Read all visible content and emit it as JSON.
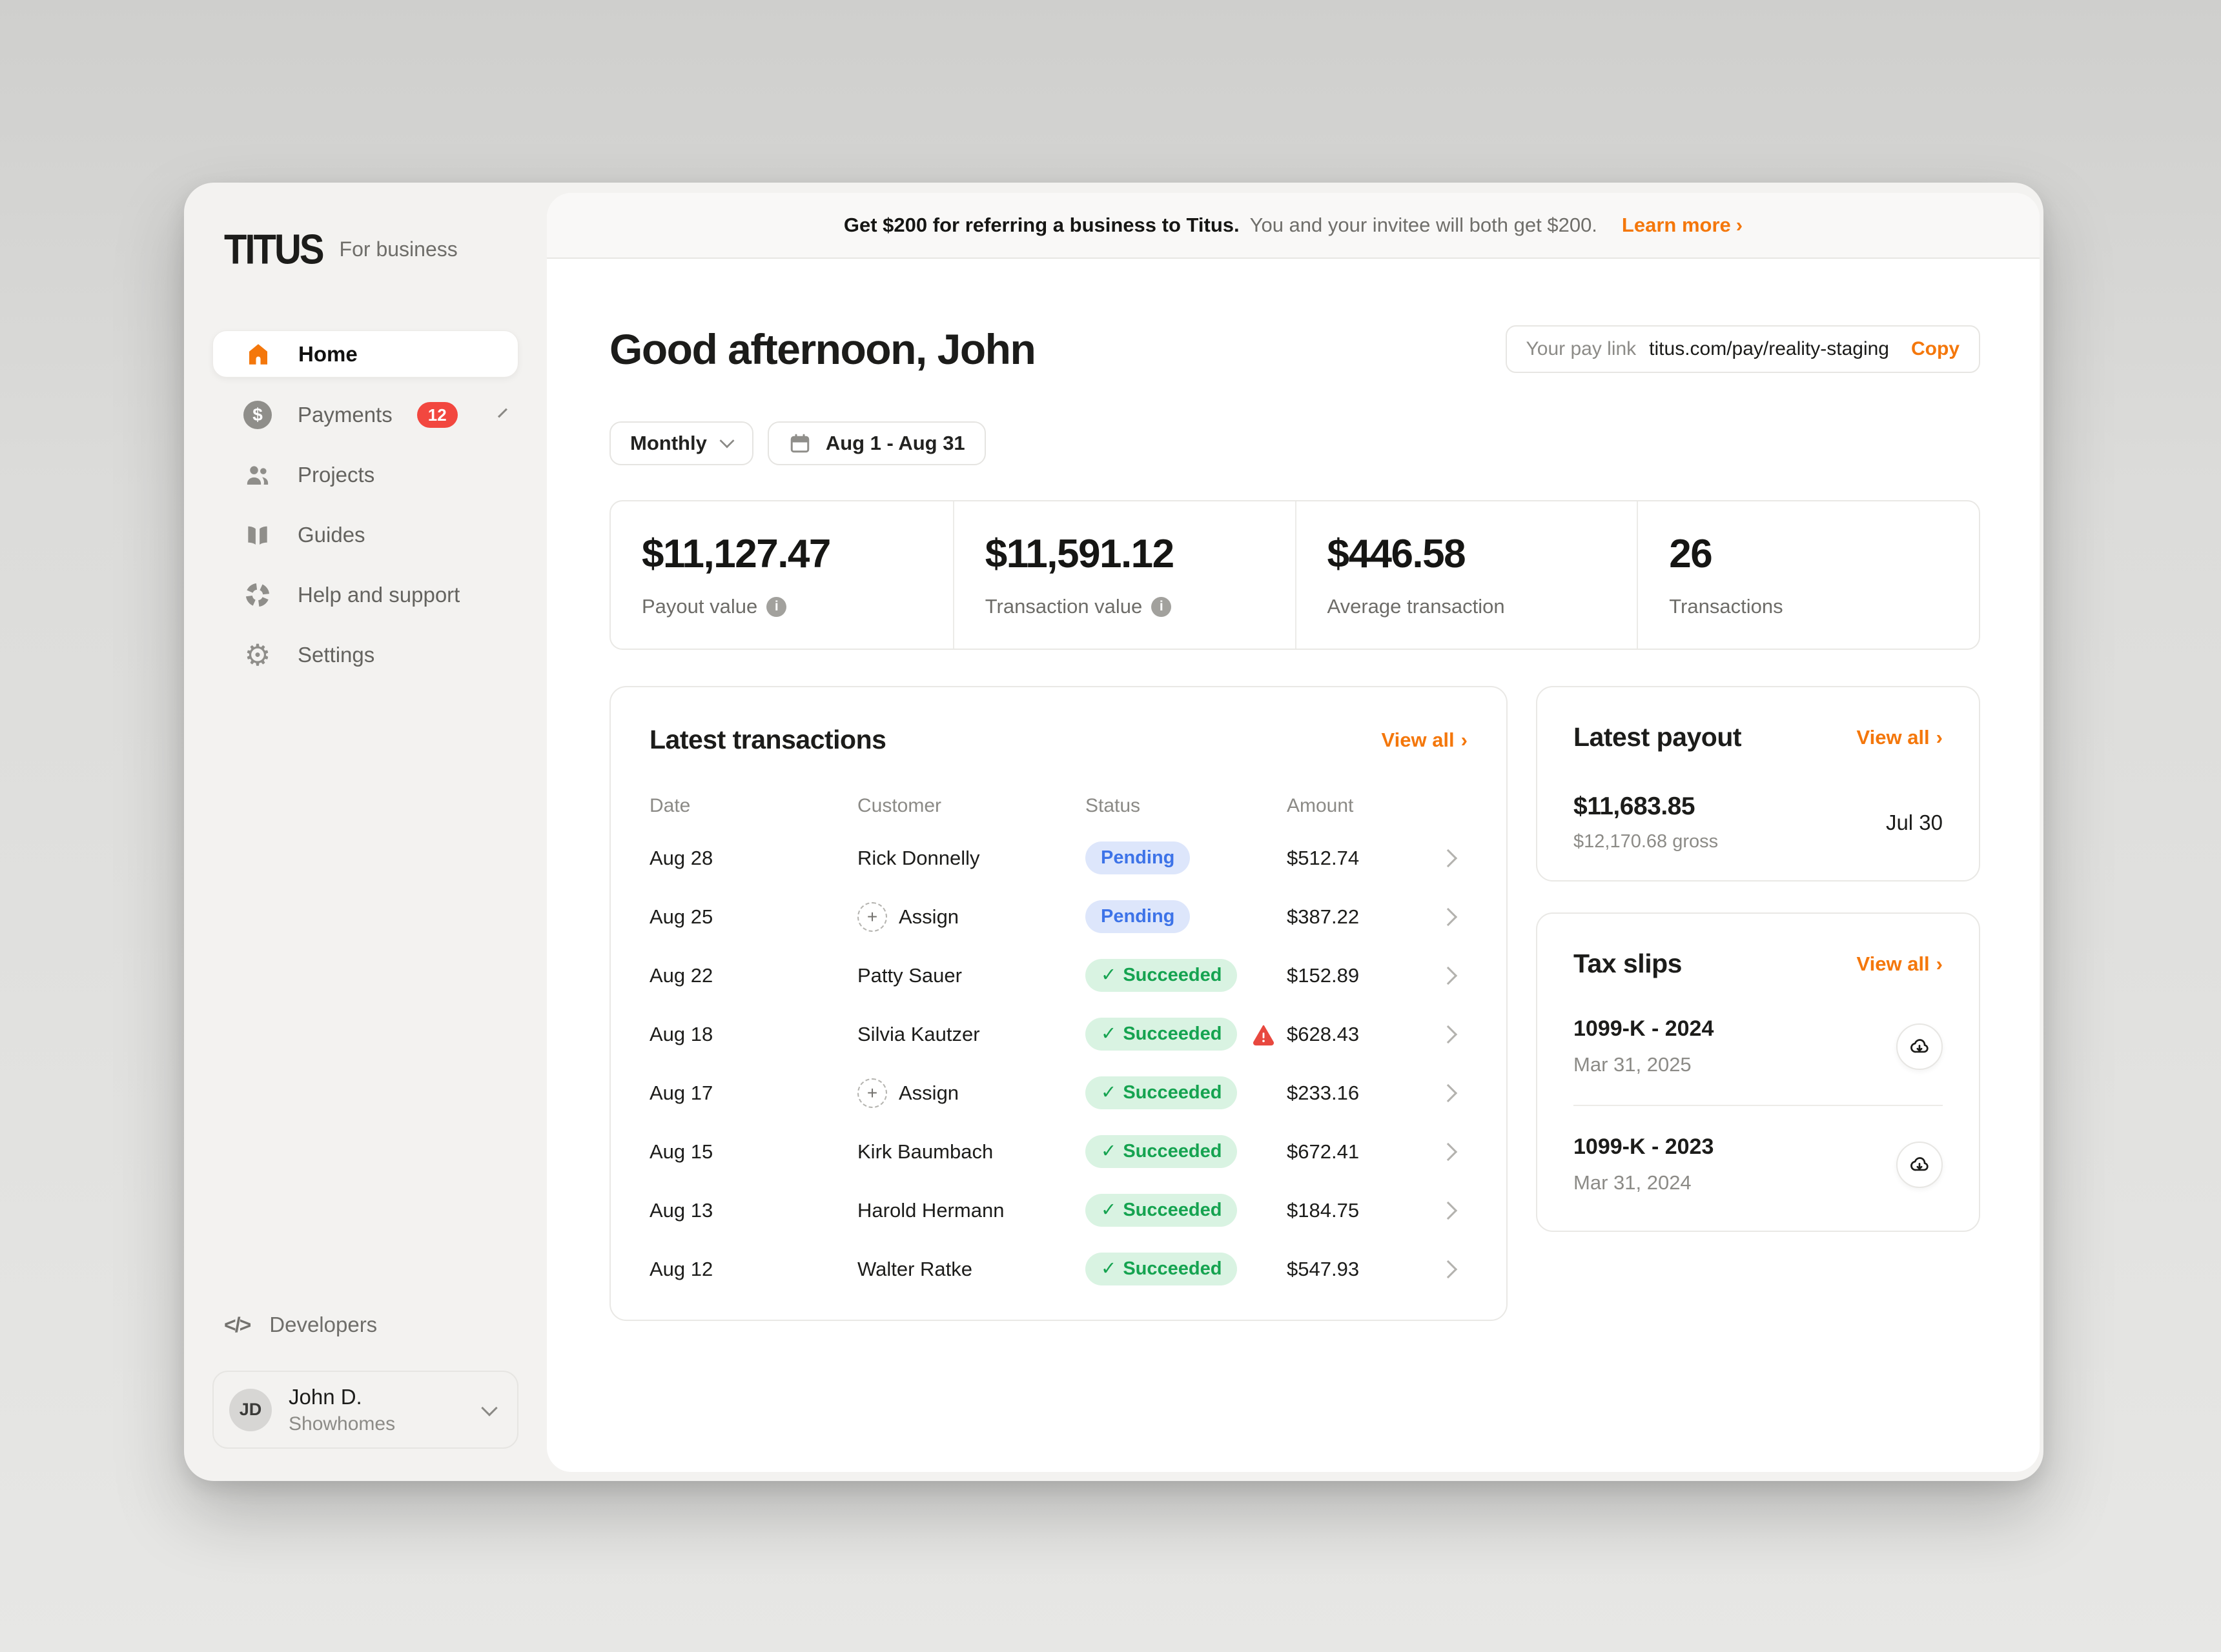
{
  "app": {
    "logo": "TITUS",
    "logo_suffix": "For business"
  },
  "glyphs": {
    "chev_right": "›",
    "check": "✓",
    "code": "</>",
    "plus": "+",
    "info": "i",
    "dollar": "$",
    "gear": "⚙"
  },
  "colors": {
    "accent": "#f4770b",
    "badge_red": "#f2473f",
    "pending_bg": "#dde6fb",
    "pending_text": "#3d73e8",
    "succeeded_bg": "#d9f3e2",
    "succeeded_text": "#15a350",
    "warning_red": "#e8483f"
  },
  "banner": {
    "bold": "Get $200 for referring a business to Titus.",
    "text": "You and your invitee will both get $200.",
    "link": "Learn more"
  },
  "sidebar": {
    "items": [
      {
        "label": "Home"
      },
      {
        "label": "Payments",
        "badge": "12"
      },
      {
        "label": "Projects"
      },
      {
        "label": "Guides"
      },
      {
        "label": "Help and support"
      },
      {
        "label": "Settings"
      }
    ],
    "developers": "Developers",
    "profile": {
      "initials": "JD",
      "name": "John D.",
      "org": "Showhomes"
    }
  },
  "header": {
    "greeting": "Good afternoon, John",
    "paylink_label": "Your pay link",
    "paylink_url": "titus.com/pay/reality-staging",
    "copy_label": "Copy"
  },
  "filters": {
    "period": "Monthly",
    "range": "Aug 1 - Aug 31"
  },
  "stats": [
    {
      "value": "$11,127.47",
      "label": "Payout value"
    },
    {
      "value": "$11,591.12",
      "label": "Transaction value"
    },
    {
      "value": "$446.58",
      "label": "Average transaction"
    },
    {
      "value": "26",
      "label": "Transactions"
    }
  ],
  "transactions": {
    "title": "Latest transactions",
    "view_all": "View all",
    "columns": [
      "Date",
      "Customer",
      "Status",
      "Amount"
    ],
    "rows": [
      {
        "date": "Aug 28",
        "customer": "Rick Donnelly",
        "status": "Pending",
        "amount": "$512.74"
      },
      {
        "date": "Aug 25",
        "customer": "Assign",
        "status": "Pending",
        "amount": "$387.22"
      },
      {
        "date": "Aug 22",
        "customer": "Patty Sauer",
        "status": "Succeeded",
        "amount": "$152.89"
      },
      {
        "date": "Aug 18",
        "customer": "Silvia Kautzer",
        "status": "Succeeded",
        "amount": "$628.43"
      },
      {
        "date": "Aug 17",
        "customer": "Assign",
        "status": "Succeeded",
        "amount": "$233.16"
      },
      {
        "date": "Aug 15",
        "customer": "Kirk Baumbach",
        "status": "Succeeded",
        "amount": "$672.41"
      },
      {
        "date": "Aug 13",
        "customer": "Harold Hermann",
        "status": "Succeeded",
        "amount": "$184.75"
      },
      {
        "date": "Aug 12",
        "customer": "Walter Ratke",
        "status": "Succeeded",
        "amount": "$547.93"
      }
    ]
  },
  "payout": {
    "title": "Latest payout",
    "view_all": "View all",
    "amount": "$11,683.85",
    "gross": "$12,170.68 gross",
    "date": "Jul 30"
  },
  "tax": {
    "title": "Tax slips",
    "view_all": "View all",
    "items": [
      {
        "name": "1099-K - 2024",
        "date": "Mar 31, 2025"
      },
      {
        "name": "1099-K - 2023",
        "date": "Mar 31, 2024"
      }
    ]
  }
}
